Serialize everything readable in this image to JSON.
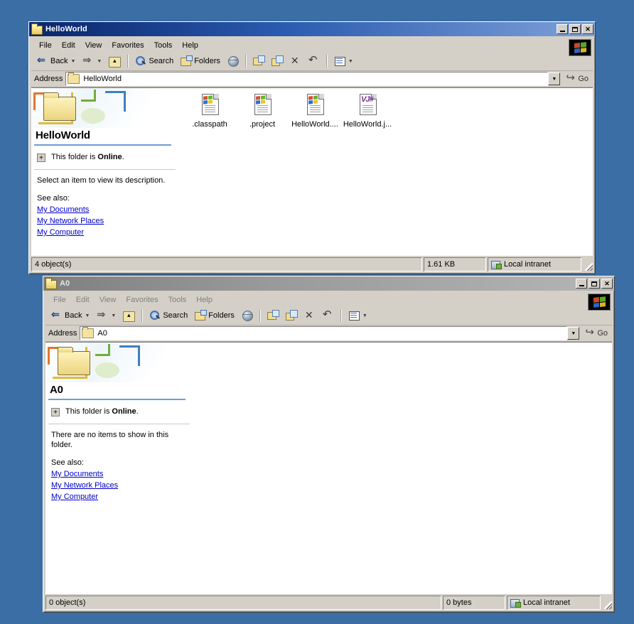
{
  "desktop": {
    "background": "#3a6ea5"
  },
  "windows": [
    {
      "id": "hello",
      "title": "HelloWorld",
      "active": true,
      "titlebar_buttons": {
        "minimize": "_",
        "maximize": "□",
        "close": "✕"
      },
      "menu": [
        "File",
        "Edit",
        "View",
        "Favorites",
        "Tools",
        "Help"
      ],
      "toolbar": {
        "back": "Back",
        "forward": "",
        "up": "",
        "search": "Search",
        "folders": "Folders",
        "history": "",
        "move_to": "",
        "copy_to": "",
        "delete": "",
        "undo": "",
        "views": ""
      },
      "address": {
        "label": "Address",
        "value": "HelloWorld",
        "go_label": "Go"
      },
      "task_pane": {
        "heading": "HelloWorld",
        "online_prefix": "This folder is ",
        "online_state": "Online",
        "online_suffix": ".",
        "description": "Select an item to view its description.",
        "see_also_label": "See also:",
        "links": [
          "My Documents",
          "My Network Places",
          "My Computer"
        ]
      },
      "files": [
        {
          "name": ".classpath",
          "icon": "windows-file-icon"
        },
        {
          "name": ".project",
          "icon": "windows-file-icon"
        },
        {
          "name": "HelloWorld....",
          "icon": "windows-file-icon"
        },
        {
          "name": "HelloWorld.j...",
          "icon": "vjsharp-file-icon"
        }
      ],
      "status": {
        "objects": "4 object(s)",
        "size": "1.61 KB",
        "zone": "Local intranet"
      }
    },
    {
      "id": "a0",
      "title": "A0",
      "active": false,
      "titlebar_buttons": {
        "minimize": "_",
        "maximize": "□",
        "close": "✕"
      },
      "menu": [
        "File",
        "Edit",
        "View",
        "Favorites",
        "Tools",
        "Help"
      ],
      "toolbar": {
        "back": "Back",
        "forward": "",
        "up": "",
        "search": "Search",
        "folders": "Folders",
        "history": "",
        "move_to": "",
        "copy_to": "",
        "delete": "",
        "undo": "",
        "views": ""
      },
      "address": {
        "label": "Address",
        "value": "A0",
        "go_label": "Go"
      },
      "task_pane": {
        "heading": "A0",
        "online_prefix": "This folder is ",
        "online_state": "Online",
        "online_suffix": ".",
        "description": "There are no items to show in this folder.",
        "see_also_label": "See also:",
        "links": [
          "My Documents",
          "My Network Places",
          "My Computer"
        ]
      },
      "files": [],
      "status": {
        "objects": "0 object(s)",
        "size": "0 bytes",
        "zone": "Local intranet"
      }
    }
  ]
}
